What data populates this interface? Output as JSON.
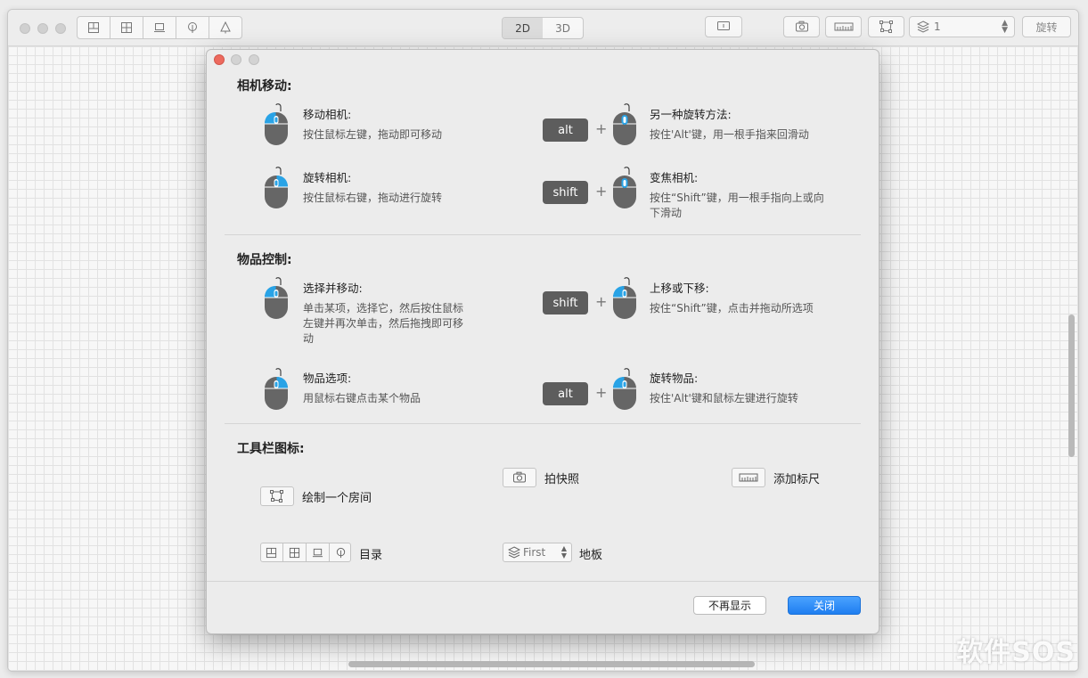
{
  "toolbar": {
    "view_2d": "2D",
    "view_3d": "3D",
    "floor_value": "1",
    "rotate_label": "旋转"
  },
  "dialog": {
    "camera": {
      "title": "相机移动:",
      "items": [
        {
          "title": "移动相机:",
          "desc": "按住鼠标左键，拖动即可移动"
        },
        {
          "title": "另一种旋转方法:",
          "desc": "按住'Alt'键，用一根手指来回滑动",
          "key": "alt"
        },
        {
          "title": "旋转相机:",
          "desc": "按住鼠标右键，拖动进行旋转"
        },
        {
          "title": "变焦相机:",
          "desc": "按住“Shift”键，用一根手指向上或向下滑动",
          "key": "shift"
        }
      ]
    },
    "objects": {
      "title": "物品控制:",
      "items": [
        {
          "title": "选择并移动:",
          "desc": "单击某项，选择它，然后按住鼠标左键并再次单击，然后拖拽即可移动"
        },
        {
          "title": "上移或下移:",
          "desc": "按住“Shift”键，点击并拖动所选项",
          "key": "shift"
        },
        {
          "title": "物品选项:",
          "desc": "用鼠标右键点击某个物品"
        },
        {
          "title": "旋转物品:",
          "desc": "按住'Alt'键和鼠标左键进行旋转",
          "key": "alt"
        }
      ]
    },
    "toolbar_icons": {
      "title": "工具栏图标:",
      "snapshot": "拍快照",
      "add_ruler": "添加标尺",
      "draw_room": "绘制一个房间",
      "catalog": "目录",
      "floor_example": "First",
      "floor": "地板"
    },
    "buttons": {
      "dont_show": "不再显示",
      "close": "关闭"
    }
  },
  "watermark": "软件SOS",
  "colors": {
    "accent": "#2f8ff5",
    "mouse_highlight": "#29a3e6",
    "key_bg": "#5d5d5d",
    "close_red": "#ed6a5e"
  }
}
